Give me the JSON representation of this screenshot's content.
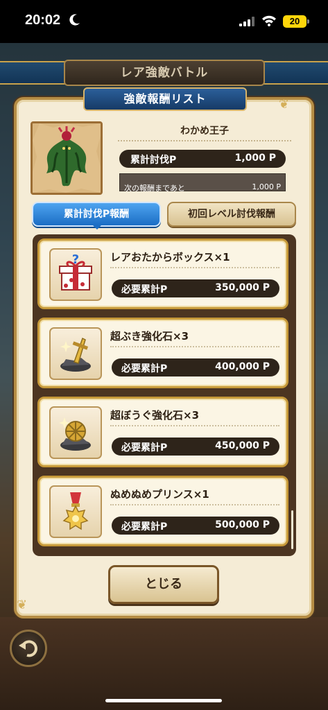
{
  "status_bar": {
    "time": "20:02",
    "battery": "20"
  },
  "header": {
    "title": "レア強敵バトル"
  },
  "panel": {
    "title": "強敵報酬リスト"
  },
  "monster": {
    "name": "わかめ王子",
    "points_label": "累計討伐P",
    "points_value": "1,000 P",
    "next_label": "次の報酬まであと",
    "next_value": "1,000 P",
    "progress_fraction": 0.0
  },
  "tabs": [
    {
      "label": "累計討伐P報酬",
      "active": true
    },
    {
      "label": "初回レベル討伐報酬",
      "active": false
    }
  ],
  "rewards": [
    {
      "name": "レアおたからボックス×1",
      "req_label": "必要累計P",
      "req_value": "350,000 P",
      "icon": "gift-box-icon"
    },
    {
      "name": "超ぶき強化石×3",
      "req_label": "必要累計P",
      "req_value": "400,000 P",
      "icon": "weapon-stone-icon"
    },
    {
      "name": "超ぼうぐ強化石×3",
      "req_label": "必要累計P",
      "req_value": "450,000 P",
      "icon": "armor-stone-icon"
    },
    {
      "name": "ぬめぬめプリンス×1",
      "req_label": "必要累計P",
      "req_value": "500,000 P",
      "icon": "medal-icon"
    }
  ],
  "close_button": {
    "label": "とじる"
  },
  "colors": {
    "accent_blue": "#1b6dc4",
    "gold_border": "#c79a3a",
    "dark_pill": "#2e241a"
  }
}
